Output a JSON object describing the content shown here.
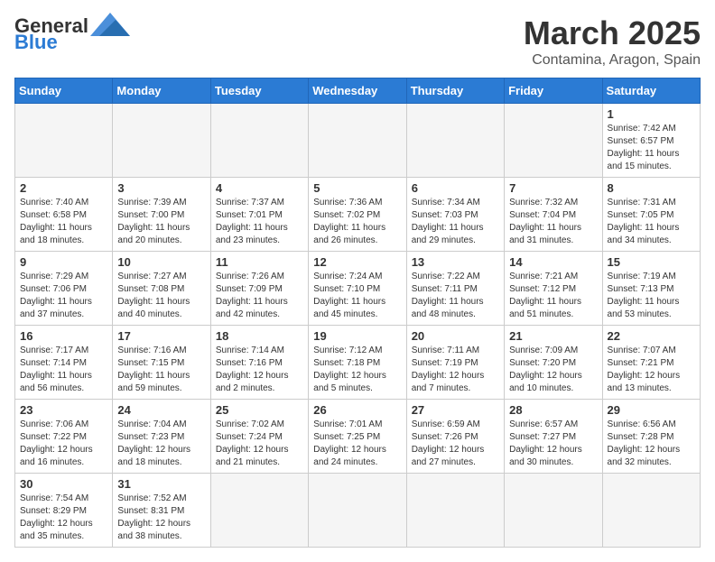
{
  "logo": {
    "general": "General",
    "blue": "Blue"
  },
  "title": "March 2025",
  "location": "Contamina, Aragon, Spain",
  "weekdays": [
    "Sunday",
    "Monday",
    "Tuesday",
    "Wednesday",
    "Thursday",
    "Friday",
    "Saturday"
  ],
  "days": [
    {
      "num": "",
      "empty": true
    },
    {
      "num": "",
      "empty": true
    },
    {
      "num": "",
      "empty": true
    },
    {
      "num": "",
      "empty": true
    },
    {
      "num": "",
      "empty": true
    },
    {
      "num": "",
      "empty": true
    },
    {
      "num": "1",
      "info": "Sunrise: 7:42 AM\nSunset: 6:57 PM\nDaylight: 11 hours and 15 minutes."
    },
    {
      "num": "2",
      "info": "Sunrise: 7:40 AM\nSunset: 6:58 PM\nDaylight: 11 hours and 18 minutes."
    },
    {
      "num": "3",
      "info": "Sunrise: 7:39 AM\nSunset: 7:00 PM\nDaylight: 11 hours and 20 minutes."
    },
    {
      "num": "4",
      "info": "Sunrise: 7:37 AM\nSunset: 7:01 PM\nDaylight: 11 hours and 23 minutes."
    },
    {
      "num": "5",
      "info": "Sunrise: 7:36 AM\nSunset: 7:02 PM\nDaylight: 11 hours and 26 minutes."
    },
    {
      "num": "6",
      "info": "Sunrise: 7:34 AM\nSunset: 7:03 PM\nDaylight: 11 hours and 29 minutes."
    },
    {
      "num": "7",
      "info": "Sunrise: 7:32 AM\nSunset: 7:04 PM\nDaylight: 11 hours and 31 minutes."
    },
    {
      "num": "8",
      "info": "Sunrise: 7:31 AM\nSunset: 7:05 PM\nDaylight: 11 hours and 34 minutes."
    },
    {
      "num": "9",
      "info": "Sunrise: 7:29 AM\nSunset: 7:06 PM\nDaylight: 11 hours and 37 minutes."
    },
    {
      "num": "10",
      "info": "Sunrise: 7:27 AM\nSunset: 7:08 PM\nDaylight: 11 hours and 40 minutes."
    },
    {
      "num": "11",
      "info": "Sunrise: 7:26 AM\nSunset: 7:09 PM\nDaylight: 11 hours and 42 minutes."
    },
    {
      "num": "12",
      "info": "Sunrise: 7:24 AM\nSunset: 7:10 PM\nDaylight: 11 hours and 45 minutes."
    },
    {
      "num": "13",
      "info": "Sunrise: 7:22 AM\nSunset: 7:11 PM\nDaylight: 11 hours and 48 minutes."
    },
    {
      "num": "14",
      "info": "Sunrise: 7:21 AM\nSunset: 7:12 PM\nDaylight: 11 hours and 51 minutes."
    },
    {
      "num": "15",
      "info": "Sunrise: 7:19 AM\nSunset: 7:13 PM\nDaylight: 11 hours and 53 minutes."
    },
    {
      "num": "16",
      "info": "Sunrise: 7:17 AM\nSunset: 7:14 PM\nDaylight: 11 hours and 56 minutes."
    },
    {
      "num": "17",
      "info": "Sunrise: 7:16 AM\nSunset: 7:15 PM\nDaylight: 11 hours and 59 minutes."
    },
    {
      "num": "18",
      "info": "Sunrise: 7:14 AM\nSunset: 7:16 PM\nDaylight: 12 hours and 2 minutes."
    },
    {
      "num": "19",
      "info": "Sunrise: 7:12 AM\nSunset: 7:18 PM\nDaylight: 12 hours and 5 minutes."
    },
    {
      "num": "20",
      "info": "Sunrise: 7:11 AM\nSunset: 7:19 PM\nDaylight: 12 hours and 7 minutes."
    },
    {
      "num": "21",
      "info": "Sunrise: 7:09 AM\nSunset: 7:20 PM\nDaylight: 12 hours and 10 minutes."
    },
    {
      "num": "22",
      "info": "Sunrise: 7:07 AM\nSunset: 7:21 PM\nDaylight: 12 hours and 13 minutes."
    },
    {
      "num": "23",
      "info": "Sunrise: 7:06 AM\nSunset: 7:22 PM\nDaylight: 12 hours and 16 minutes."
    },
    {
      "num": "24",
      "info": "Sunrise: 7:04 AM\nSunset: 7:23 PM\nDaylight: 12 hours and 18 minutes."
    },
    {
      "num": "25",
      "info": "Sunrise: 7:02 AM\nSunset: 7:24 PM\nDaylight: 12 hours and 21 minutes."
    },
    {
      "num": "26",
      "info": "Sunrise: 7:01 AM\nSunset: 7:25 PM\nDaylight: 12 hours and 24 minutes."
    },
    {
      "num": "27",
      "info": "Sunrise: 6:59 AM\nSunset: 7:26 PM\nDaylight: 12 hours and 27 minutes."
    },
    {
      "num": "28",
      "info": "Sunrise: 6:57 AM\nSunset: 7:27 PM\nDaylight: 12 hours and 30 minutes."
    },
    {
      "num": "29",
      "info": "Sunrise: 6:56 AM\nSunset: 7:28 PM\nDaylight: 12 hours and 32 minutes."
    },
    {
      "num": "30",
      "info": "Sunrise: 7:54 AM\nSunset: 8:29 PM\nDaylight: 12 hours and 35 minutes."
    },
    {
      "num": "31",
      "info": "Sunrise: 7:52 AM\nSunset: 8:31 PM\nDaylight: 12 hours and 38 minutes."
    },
    {
      "num": "",
      "empty": true
    },
    {
      "num": "",
      "empty": true
    },
    {
      "num": "",
      "empty": true
    },
    {
      "num": "",
      "empty": true
    },
    {
      "num": "",
      "empty": true
    }
  ]
}
